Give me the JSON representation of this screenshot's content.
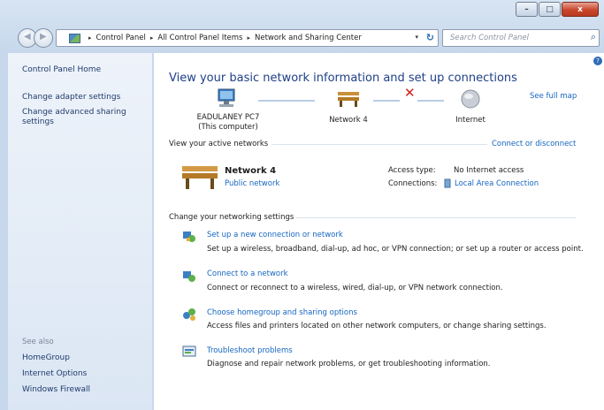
{
  "window": {
    "controls": {
      "minimize": "–",
      "maximize": "□",
      "close": "x"
    }
  },
  "address": {
    "crumbs": [
      "Control Panel",
      "All Control Panel Items",
      "Network and Sharing Center"
    ],
    "separator": "▸",
    "dropdown": "▾",
    "refresh": "↻"
  },
  "search": {
    "placeholder": "Search Control Panel",
    "icon": "search-icon"
  },
  "sidebar": {
    "home": "Control Panel Home",
    "links": [
      "Change adapter settings",
      "Change advanced sharing settings"
    ],
    "see_also_title": "See also",
    "see_also": [
      "HomeGroup",
      "Internet Options",
      "Windows Firewall"
    ]
  },
  "main": {
    "title": "View your basic network information and set up connections",
    "see_full_map": "See full map",
    "map": {
      "computer": {
        "name": "EADULANEY PC7",
        "sub": "(This computer)",
        "icon": "computer-icon"
      },
      "network": {
        "name": "Network 4",
        "icon": "bench-icon"
      },
      "internet": {
        "name": "Internet",
        "icon": "globe-icon"
      },
      "broken": "✕"
    },
    "active_label": "View your active networks",
    "connect_link": "Connect or disconnect",
    "active_network": {
      "name": "Network 4",
      "type": "Public network",
      "access_type_label": "Access type:",
      "access_type": "No Internet access",
      "connections_label": "Connections:",
      "connection": "Local Area Connection"
    },
    "change_label": "Change your networking settings",
    "tasks": [
      {
        "link": "Set up a new connection or network",
        "desc": "Set up a wireless, broadband, dial-up, ad hoc, or VPN connection; or set up a router or access point.",
        "icon": "new-connection-icon"
      },
      {
        "link": "Connect to a network",
        "desc": "Connect or reconnect to a wireless, wired, dial-up, or VPN network connection.",
        "icon": "connect-network-icon"
      },
      {
        "link": "Choose homegroup and sharing options",
        "desc": "Access files and printers located on other network computers, or change sharing settings.",
        "icon": "homegroup-icon"
      },
      {
        "link": "Troubleshoot problems",
        "desc": "Diagnose and repair network problems, or get troubleshooting information.",
        "icon": "troubleshoot-icon"
      }
    ]
  },
  "colors": {
    "link": "#1565c0",
    "title": "#1e3f87",
    "sidebar_link": "#1f3a6a"
  }
}
